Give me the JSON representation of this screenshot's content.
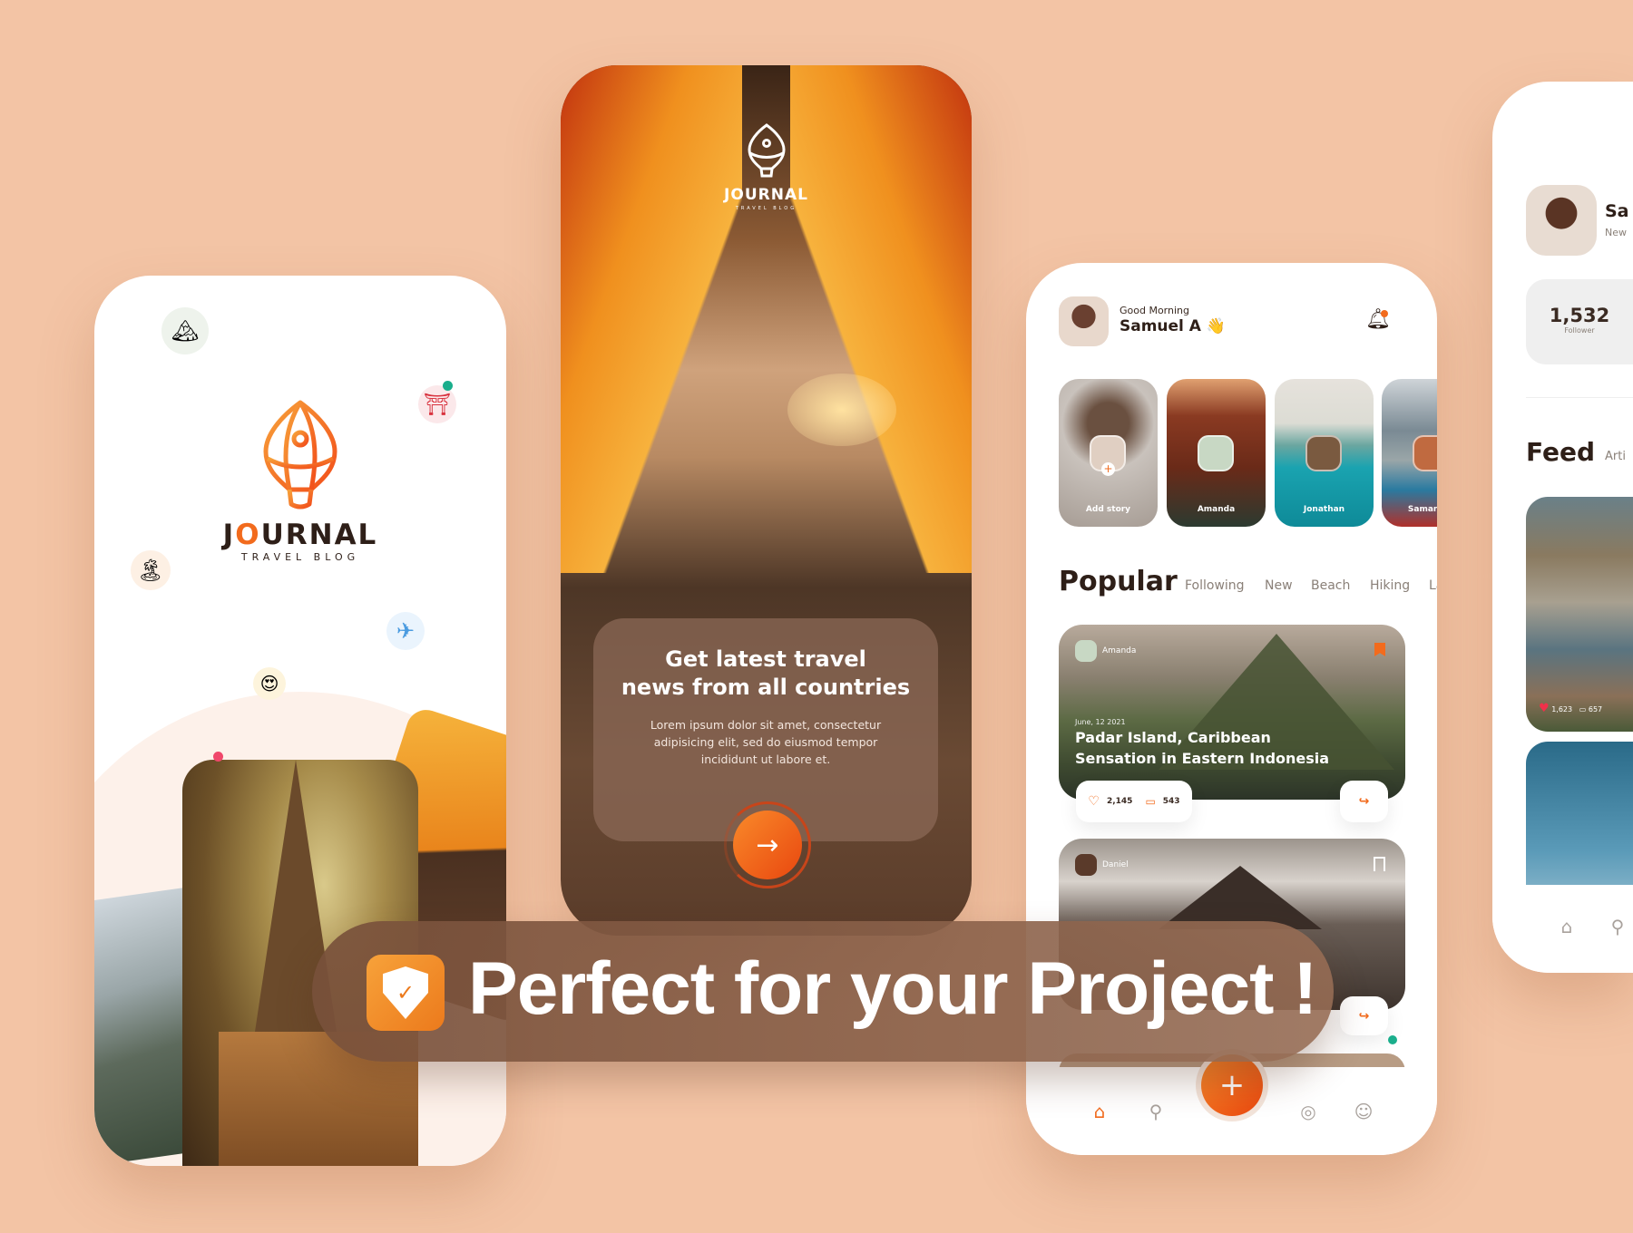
{
  "splash": {
    "brand": "JOURNAL",
    "brand_highlight": "O",
    "tagline": "TRAVEL BLOG",
    "emojis": [
      "🏔",
      "⛩",
      "🏝",
      "✈",
      "😍"
    ]
  },
  "onboarding": {
    "brand": "JOURNAL",
    "tagline": "TRAVEL BLOG",
    "title_line1": "Get latest travel",
    "title_line2": "news from all countries",
    "body": "Lorem ipsum dolor sit amet, consectetur adipisicing elit, sed do eiusmod tempor incididunt ut labore et.",
    "next_icon": "arrow-right-icon"
  },
  "home": {
    "greeting": "Good Morning",
    "user_name": "Samuel A",
    "wave": "👋",
    "stories": [
      {
        "name": "Add story"
      },
      {
        "name": "Amanda"
      },
      {
        "name": "Jonathan"
      },
      {
        "name": "Samantha"
      }
    ],
    "section_title": "Popular",
    "tabs": [
      "Following",
      "New",
      "Beach",
      "Hiking",
      "La"
    ],
    "posts": [
      {
        "author": "Amanda",
        "date": "June, 12 2021",
        "title_line1": "Padar Island, Caribbean",
        "title_line2": "Sensation in Eastern Indonesia",
        "likes": "2,145",
        "comments": "543",
        "bookmarked": true
      },
      {
        "author": "Daniel",
        "bookmarked": false
      }
    ],
    "nav": [
      "home-icon",
      "search-icon",
      "add-icon",
      "compass-icon",
      "profile-icon"
    ],
    "add_label": "+"
  },
  "profile": {
    "name": "Sa",
    "subtitle": "New",
    "followers": "1,532",
    "followers_label": "Follower",
    "feed_title": "Feed",
    "feed_tab": "Arti",
    "feed_likes": "1,623",
    "feed_comments": "657"
  },
  "banner": {
    "text": "Perfect for your Project !"
  },
  "colors": {
    "accent": "#f26b1d",
    "background": "#f3c4a5",
    "text_dark": "#2e1f18"
  }
}
